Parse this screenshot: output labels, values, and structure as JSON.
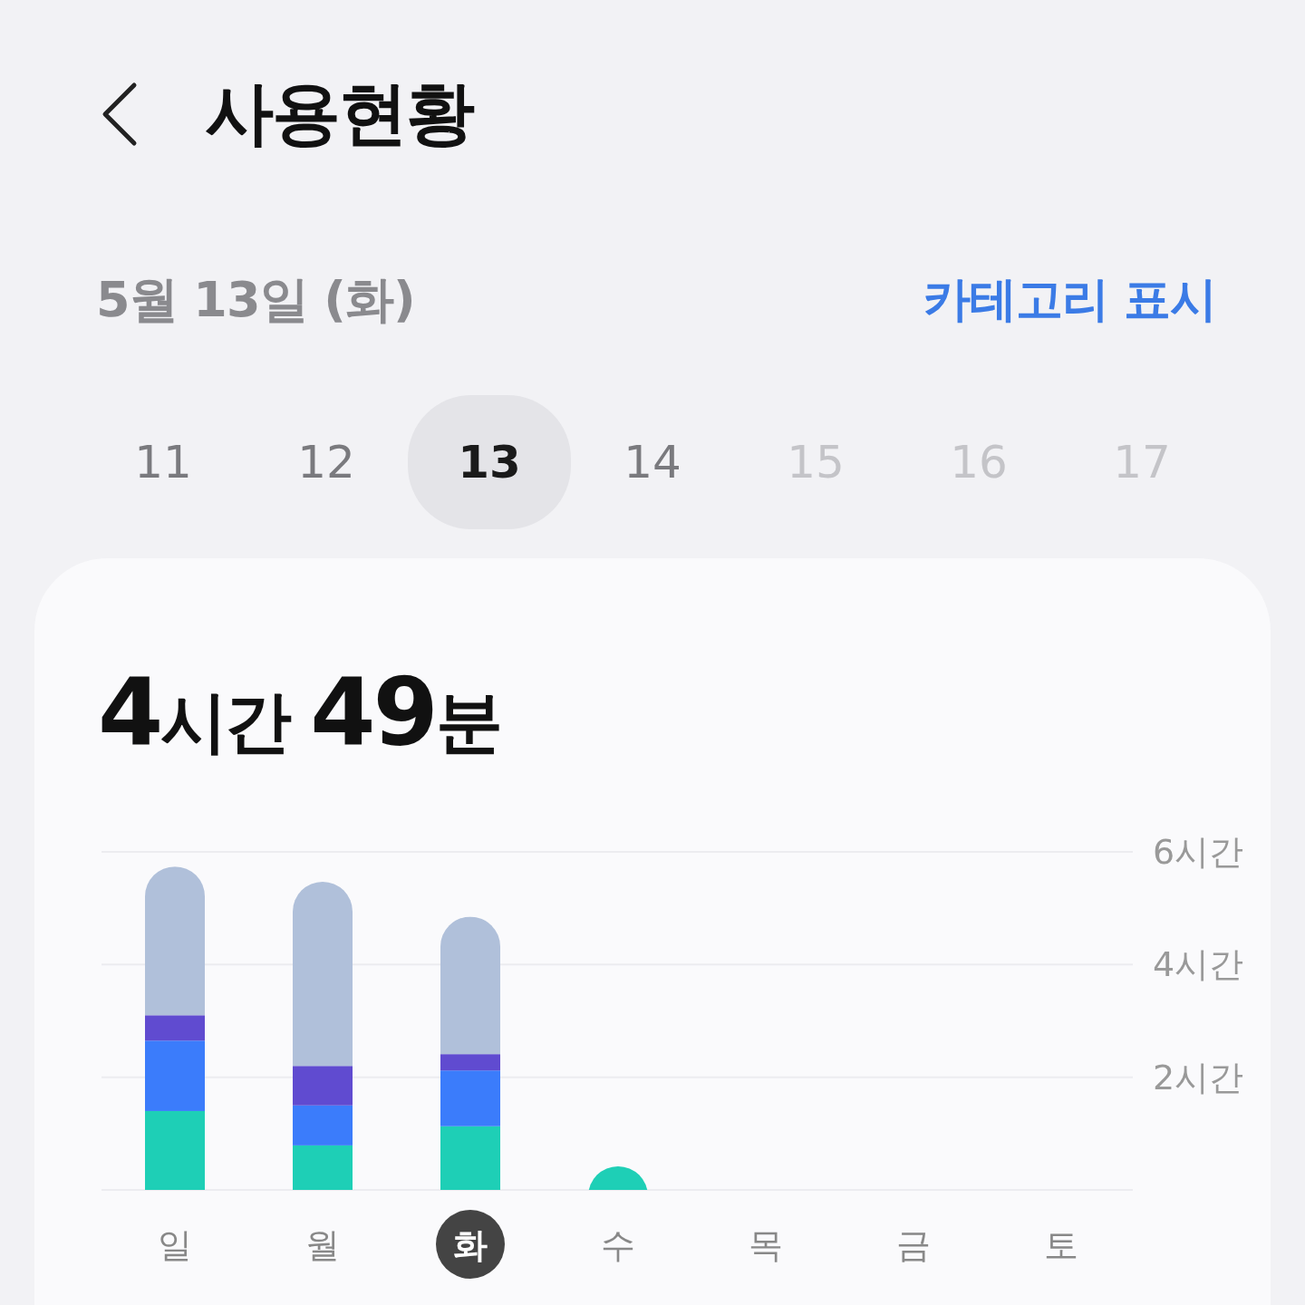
{
  "header": {
    "title": "사용현황"
  },
  "date_row": {
    "date": "5월 13일 (화)",
    "action": "카테고리 표시"
  },
  "days": [
    {
      "label": "11",
      "selected": false,
      "disabled": false
    },
    {
      "label": "12",
      "selected": false,
      "disabled": false
    },
    {
      "label": "13",
      "selected": true,
      "disabled": false
    },
    {
      "label": "14",
      "selected": false,
      "disabled": false
    },
    {
      "label": "15",
      "selected": false,
      "disabled": true
    },
    {
      "label": "16",
      "selected": false,
      "disabled": true
    },
    {
      "label": "17",
      "selected": false,
      "disabled": true
    }
  ],
  "card": {
    "total": [
      {
        "kind": "number",
        "text": "4"
      },
      {
        "kind": "unit",
        "text": "시간 "
      },
      {
        "kind": "number",
        "text": "49"
      },
      {
        "kind": "unit",
        "text": "분"
      }
    ],
    "day_selected": [
      false,
      false,
      true,
      false,
      false,
      false,
      false
    ],
    "chart_data": {
      "type": "bar",
      "stacked": true,
      "categories": [
        "일",
        "월",
        "화",
        "수",
        "목",
        "금",
        "토"
      ],
      "ylim": [
        0,
        6
      ],
      "yticks": [
        {
          "value": 2,
          "label": "2시간"
        },
        {
          "value": 4,
          "label": "4시간"
        },
        {
          "value": 6,
          "label": "6시간"
        }
      ],
      "series": [
        {
          "color": "#1ecfb6",
          "values": [
            1.4,
            0.79,
            1.13,
            0.42,
            null,
            null,
            null
          ]
        },
        {
          "color": "#3b7cfb",
          "values": [
            1.25,
            0.71,
            0.99,
            0,
            null,
            null,
            null
          ]
        },
        {
          "color": "#604bd0",
          "values": [
            0.45,
            0.7,
            0.29,
            0,
            null,
            null,
            null
          ]
        },
        {
          "color": "#b0c0da",
          "values": [
            2.64,
            3.27,
            2.44,
            0,
            null,
            null,
            null
          ]
        }
      ]
    }
  }
}
